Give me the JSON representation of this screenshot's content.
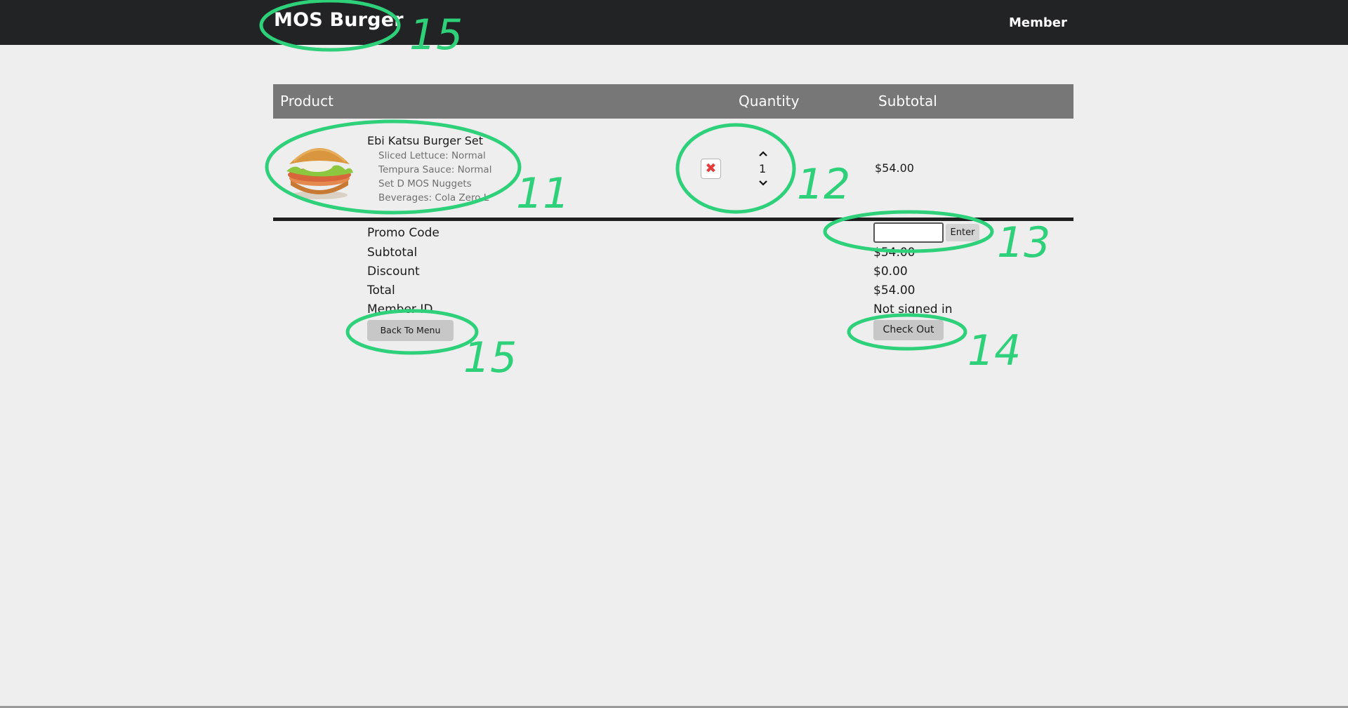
{
  "nav": {
    "brand": "MOS Burger",
    "member_link": "Member"
  },
  "cart": {
    "headers": {
      "product": "Product",
      "quantity": "Quantity",
      "subtotal": "Subtotal"
    },
    "items": [
      {
        "name": "Ebi Katsu Burger Set",
        "options": [
          "Sliced Lettuce: Normal",
          "Tempura Sauce: Normal",
          "Set D MOS Nuggets",
          "Beverages: Cola Zero L"
        ],
        "quantity": "1",
        "subtotal": "$54.00"
      }
    ]
  },
  "summary": {
    "promo_label": "Promo Code",
    "promo_value": "",
    "enter_label": "Enter",
    "subtotal_label": "Subtotal",
    "subtotal_value": "$54.00",
    "discount_label": "Discount",
    "discount_value": "$0.00",
    "total_label": "Total",
    "total_value": "$54.00",
    "member_id_label": "Member ID",
    "member_id_value": "Not signed in",
    "back_label": "Back To Menu",
    "checkout_label": "Check Out"
  },
  "icons": {
    "remove": "close-icon",
    "increase": "chevron-up-icon",
    "decrease": "chevron-down-icon"
  },
  "annotations": {
    "color": "#2fd07a",
    "labels": [
      "15",
      "11",
      "12",
      "13",
      "15",
      "14"
    ]
  },
  "colors": {
    "topbar": "#222324",
    "table_header": "#777777",
    "remove_icon": "#e43b3b"
  }
}
